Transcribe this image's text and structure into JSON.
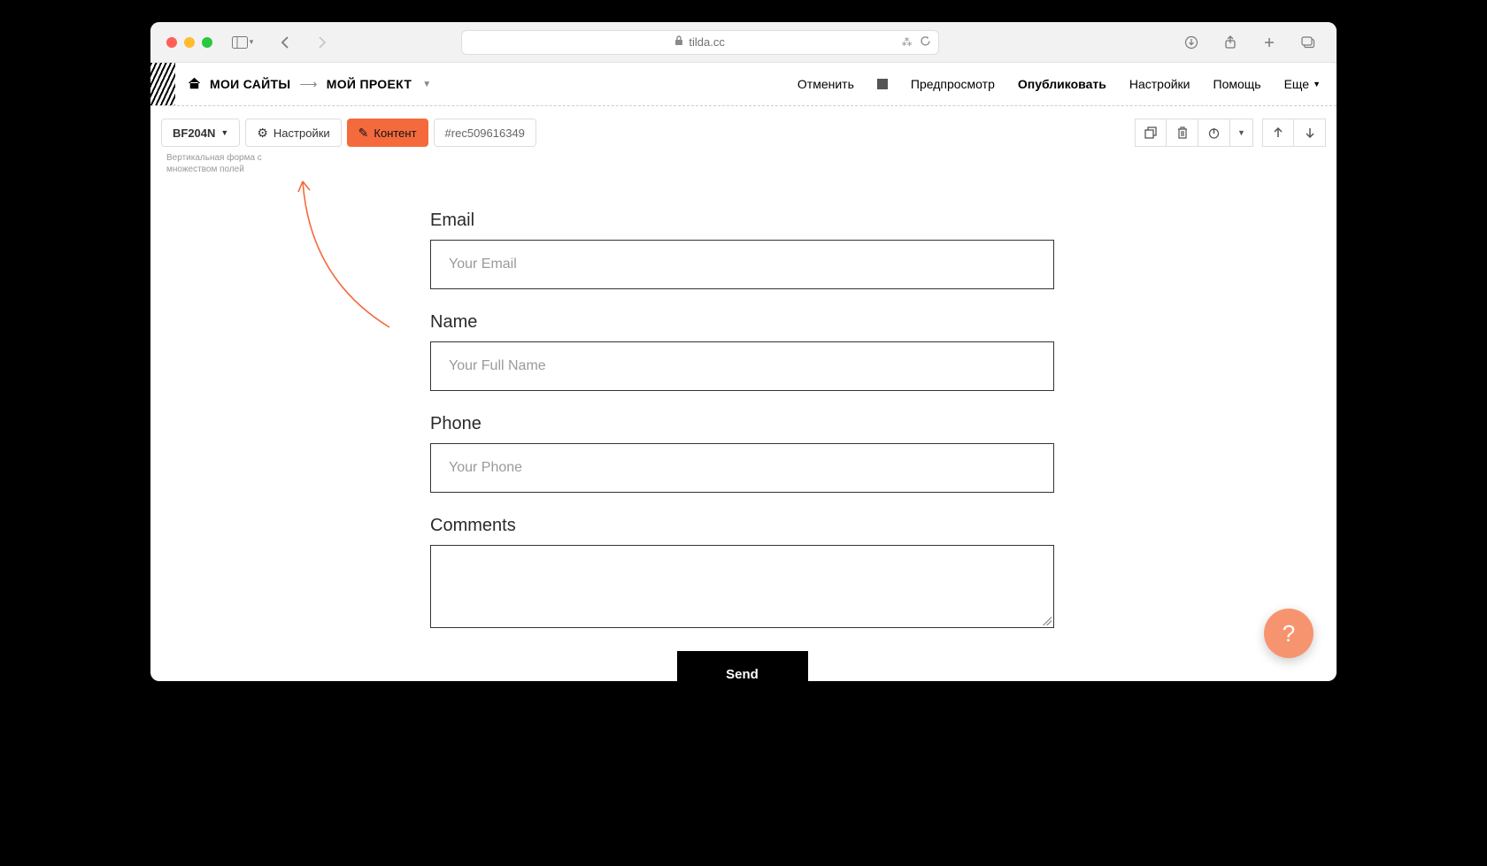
{
  "browser": {
    "url_host": "tilda.cc"
  },
  "header": {
    "crumb_sites": "МОИ САЙТЫ",
    "crumb_project": "МОЙ ПРОЕКТ",
    "cancel": "Отменить",
    "preview": "Предпросмотр",
    "publish": "Опубликовать",
    "settings": "Настройки",
    "help": "Помощь",
    "more": "Еще"
  },
  "block_toolbar": {
    "block_code": "BF204N",
    "settings_btn": "Настройки",
    "content_btn": "Контент",
    "rec_id": "#rec509616349",
    "description": "Вертикальная форма с множеством полей"
  },
  "form": {
    "fields": [
      {
        "label": "Email",
        "placeholder": "Your Email",
        "type": "text"
      },
      {
        "label": "Name",
        "placeholder": "Your Full Name",
        "type": "text"
      },
      {
        "label": "Phone",
        "placeholder": "Your Phone",
        "type": "text"
      },
      {
        "label": "Comments",
        "placeholder": "",
        "type": "textarea"
      }
    ],
    "submit_label": "Send"
  },
  "help_fab": "?"
}
